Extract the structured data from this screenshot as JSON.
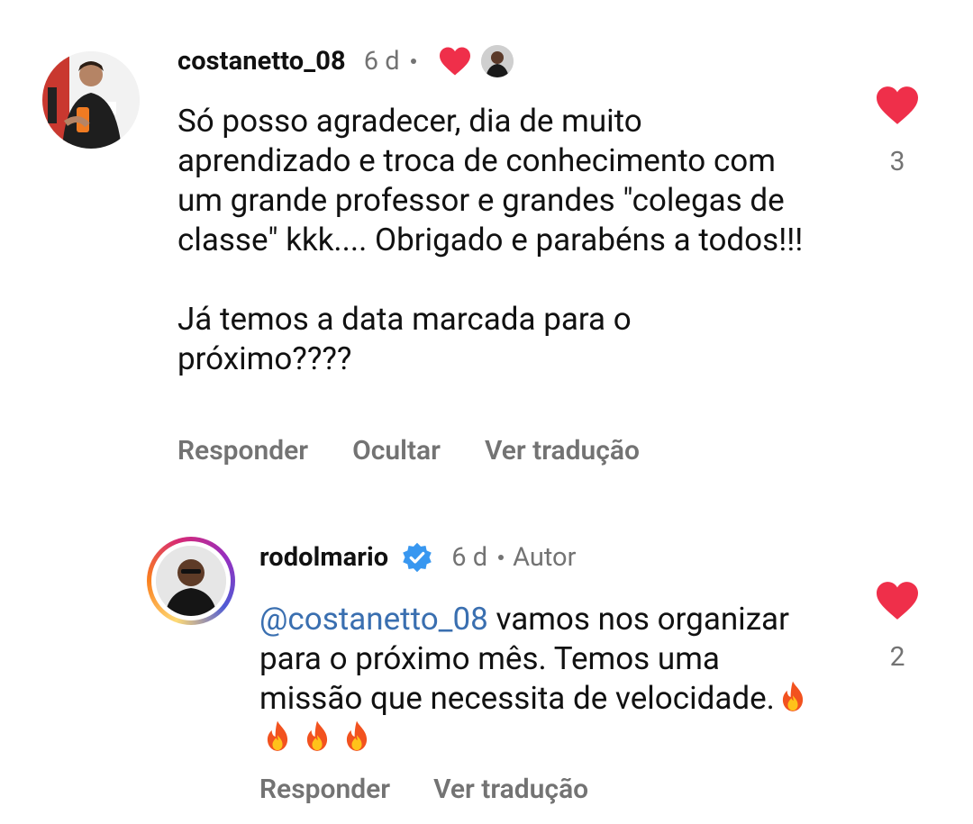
{
  "comments": [
    {
      "username": "costanetto_08",
      "time": "6 d",
      "liked_by_author": true,
      "text": "Só posso agradecer, dia de muito aprendizado e troca de conhecimento com um grande professor e grandes \"colegas de classe\" kkk.... Obrigado e parabéns a todos!!!\n\nJá temos a data marcada para o próximo????",
      "actions": [
        "Responder",
        "Ocultar",
        "Ver tradução"
      ],
      "likes": "3"
    },
    {
      "username": "rodolmario",
      "verified": true,
      "time": "6 d",
      "author_label": "Autor",
      "mention": "@costanetto_08",
      "text": " vamos nos organizar para o próximo mês. Temos uma missão que necessita de velocidade.",
      "emoji": "🔥🔥🔥🔥",
      "actions": [
        "Responder",
        "Ver tradução"
      ],
      "likes": "2"
    }
  ],
  "colors": {
    "heart": "#ef2f4a",
    "secondary_text": "#737373",
    "mention": "#3a6fb0",
    "verified": "#3897f0"
  },
  "icons": {
    "like": "heart-icon",
    "verified": "verified-badge-icon",
    "emoji": "fire-emoji"
  }
}
